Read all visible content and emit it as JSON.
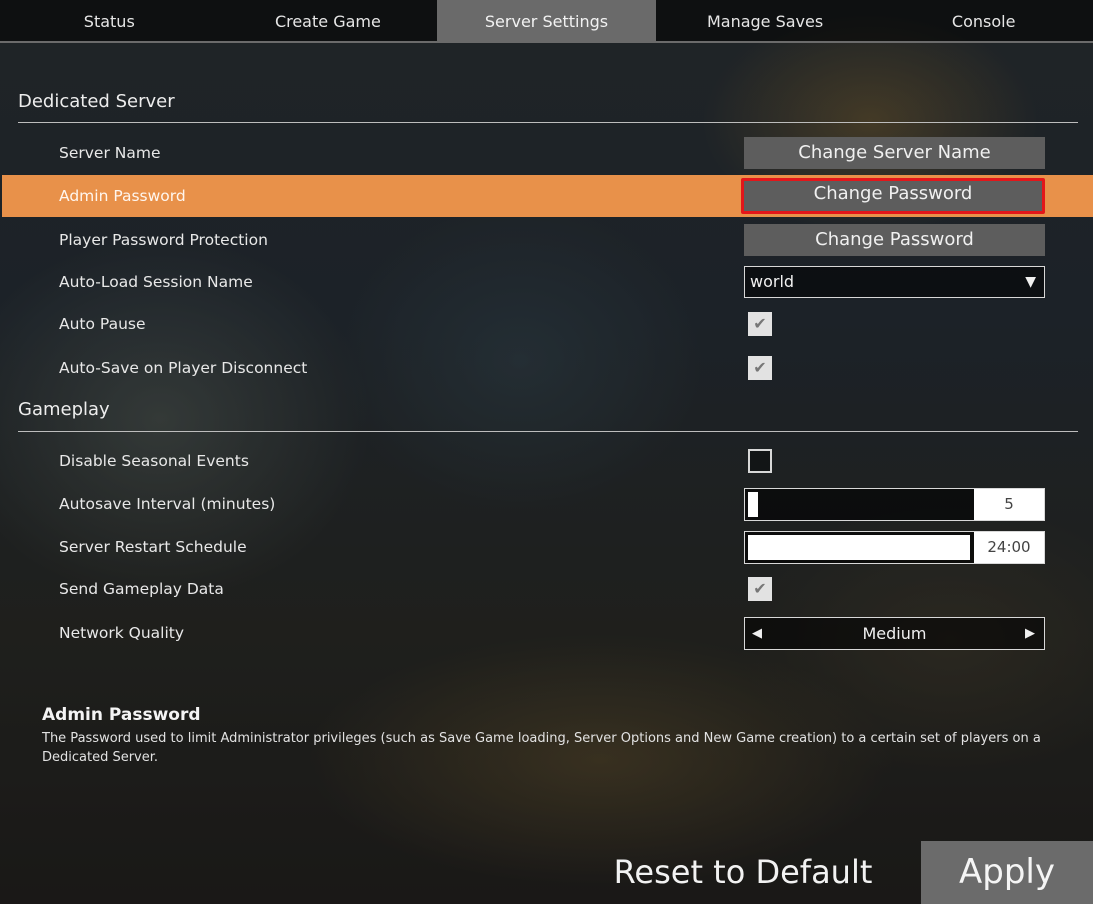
{
  "tabs": [
    {
      "label": "Status"
    },
    {
      "label": "Create Game"
    },
    {
      "label": "Server Settings",
      "active": true
    },
    {
      "label": "Manage Saves"
    },
    {
      "label": "Console"
    }
  ],
  "sections": {
    "dedicated": {
      "title": "Dedicated Server"
    },
    "gameplay": {
      "title": "Gameplay"
    }
  },
  "dedicated": {
    "server_name": {
      "label": "Server Name",
      "button": "Change Server Name"
    },
    "admin_password": {
      "label": "Admin Password",
      "button": "Change Password"
    },
    "player_password": {
      "label": "Player Password Protection",
      "button": "Change Password"
    },
    "auto_load": {
      "label": "Auto-Load Session Name",
      "value": "world"
    },
    "auto_pause": {
      "label": "Auto Pause",
      "checked": true
    },
    "auto_save_disconnect": {
      "label": "Auto-Save on Player Disconnect",
      "checked": true
    }
  },
  "gameplay": {
    "disable_seasonal": {
      "label": "Disable Seasonal Events",
      "checked": false
    },
    "autosave_interval": {
      "label": "Autosave Interval (minutes)",
      "value": "5",
      "fill_fraction": 0.04
    },
    "restart_schedule": {
      "label": "Server Restart Schedule",
      "value": "24:00",
      "fill_fraction": 1.0
    },
    "send_gameplay_data": {
      "label": "Send Gameplay Data",
      "checked": true
    },
    "network_quality": {
      "label": "Network Quality",
      "value": "Medium"
    }
  },
  "description": {
    "title": "Admin Password",
    "text": "The Password used to limit Administrator privileges (such as Save Game loading, Server Options and New Game creation) to a certain set of players on a Dedicated Server."
  },
  "footer": {
    "reset_label": "Reset to Default",
    "apply_label": "Apply"
  },
  "colors": {
    "highlight": "#e8914a",
    "focus_outline": "#e3161a",
    "button_bg": "#5d5d5d",
    "active_tab": "#6a6a6a"
  },
  "icons": {
    "dropdown": "triangle-down-icon",
    "checkmark": "checkmark-icon",
    "left_arrow": "triangle-left-icon",
    "right_arrow": "triangle-right-icon"
  }
}
